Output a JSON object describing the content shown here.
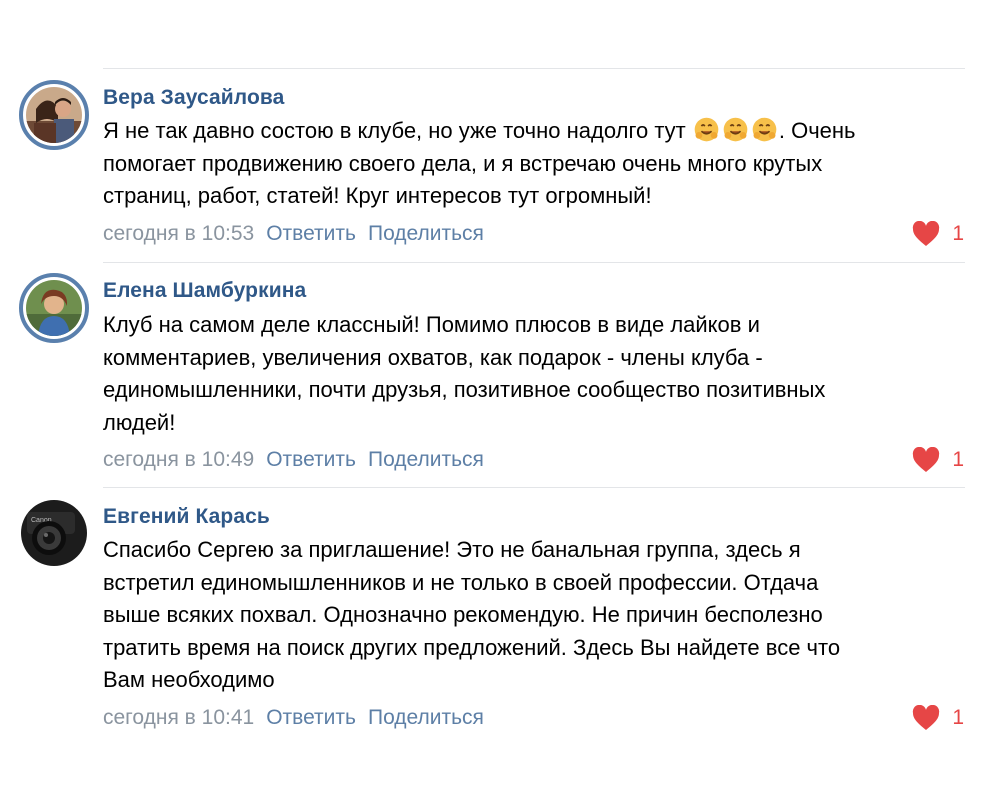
{
  "comments": [
    {
      "author": "Вера Заусайлова",
      "lines": [
        "Я не так давно состою в клубе, но уже точно надолго тут",
        "помогает продвижению своего дела, и я встречаю очень много крутых",
        "страниц, работ, статей! Круг интересов тут огромный!"
      ],
      "line1_tail": ". Очень",
      "emoji": "hugging-face-emoji",
      "time": "сегодня в 10:53",
      "reply_label": "Ответить",
      "share_label": "Поделиться",
      "likes": "1"
    },
    {
      "author": "Елена Шамбуркина",
      "lines": [
        "Клуб на самом деле классный! Помимо плюсов в виде лайков и",
        "комментариев, увеличения охватов, как подарок - члены клуба -",
        "единомышленники, почти друзья, позитивное сообщество позитивных",
        "людей!"
      ],
      "time": "сегодня в 10:49",
      "reply_label": "Ответить",
      "share_label": "Поделиться",
      "likes": "1"
    },
    {
      "author": "Евгений Карась",
      "lines": [
        "Спасибо Сергею за приглашение! Это не банальная группа, здесь я",
        "встретил единомышленников и не только в своей профессии. Отдача",
        "выше всяких похвал. Однозначно рекомендую. Не причин бесполезно",
        "тратить время на поиск других предложений. Здесь Вы найдете все что",
        "Вам необходимо"
      ],
      "time": "сегодня в 10:41",
      "reply_label": "Ответить",
      "share_label": "Поделиться",
      "likes": "1"
    }
  ],
  "colors": {
    "author": "#2f5888",
    "link": "#5d7fa6",
    "time": "#8a949f",
    "like": "#e64646",
    "divider": "#e3e5e8"
  }
}
